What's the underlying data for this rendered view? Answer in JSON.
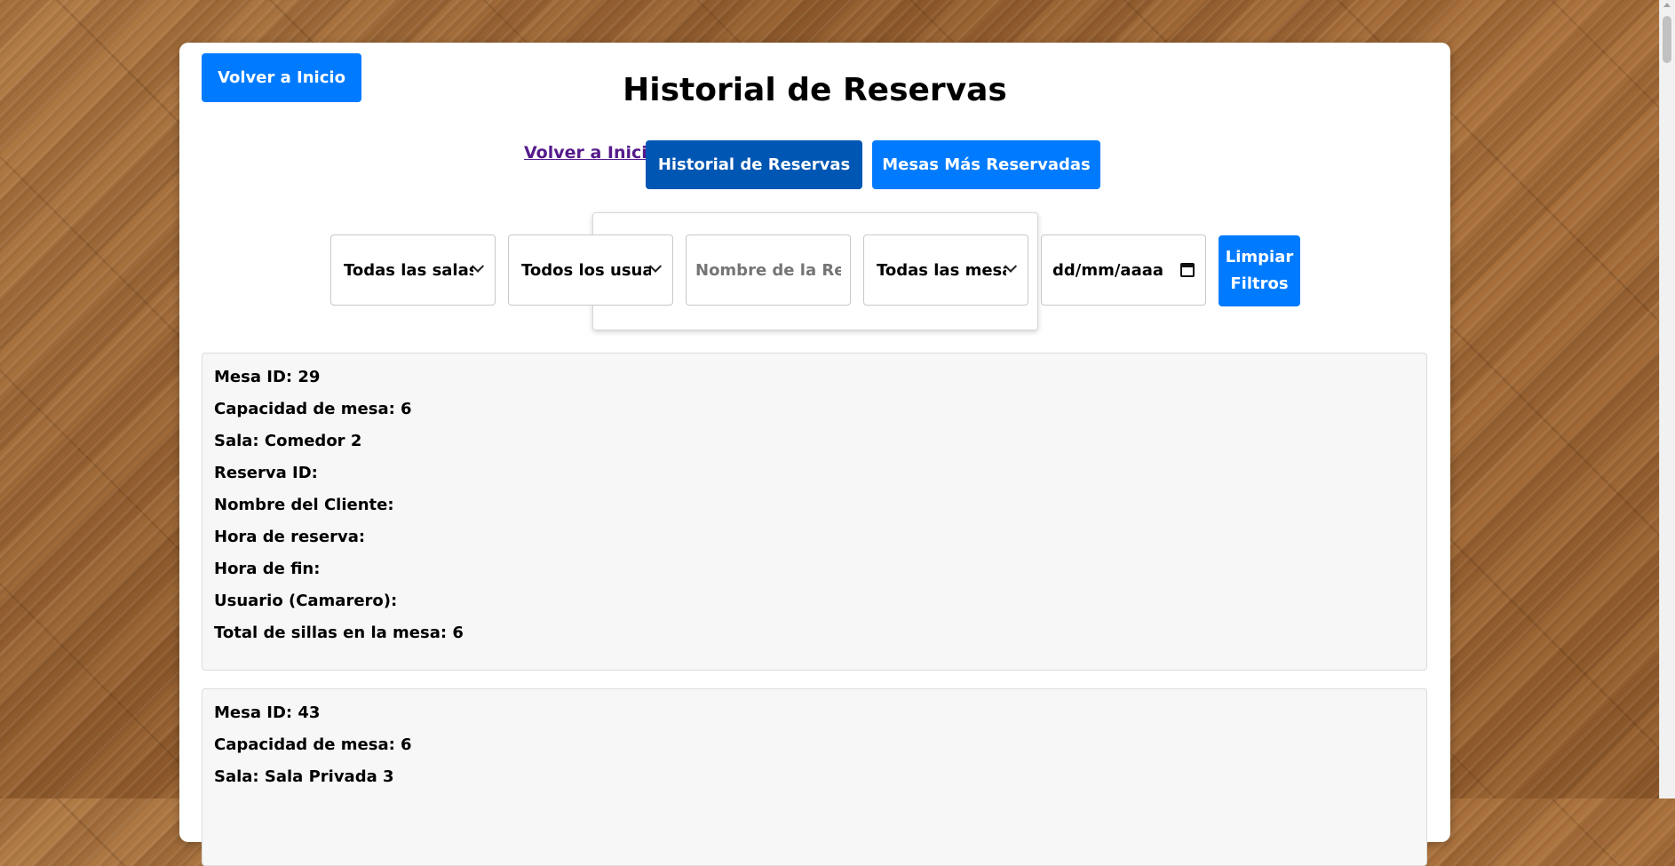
{
  "header": {
    "back_button_label": "Volver a Inicio",
    "title": "Historial de Reservas"
  },
  "nav": {
    "link_label": "Volver a Inicio",
    "historial_label": "Historial de Reservas",
    "mesas_label": "Mesas Más Reservadas"
  },
  "filters": {
    "sala_value": "Todas las salas",
    "usuario_value": "Todos los usuarios",
    "nombre_placeholder": "Nombre de la Reserva",
    "mesa_value": "Todas las mesas",
    "date_placeholder": "dd/mm/aaaa",
    "clear_label_line1": "Limpiar",
    "clear_label_line2": "Filtros"
  },
  "records": [
    {
      "mesa_id": "Mesa ID: 29",
      "capacidad": "Capacidad de mesa: 6",
      "sala": "Sala: Comedor 2",
      "reserva_id": "Reserva ID:",
      "cliente": "Nombre del Cliente:",
      "hora_reserva": "Hora de reserva:",
      "hora_fin": "Hora de fin:",
      "usuario": "Usuario (Camarero):",
      "total_sillas": "Total de sillas en la mesa: 6"
    },
    {
      "mesa_id": "Mesa ID: 43",
      "capacidad": "Capacidad de mesa: 6",
      "sala": "Sala: Sala Privada 3"
    }
  ],
  "colors": {
    "primary": "#007bff",
    "primary_active": "#0056b3",
    "visited_link": "#551a8b",
    "record_bg": "#f7f7f7"
  }
}
